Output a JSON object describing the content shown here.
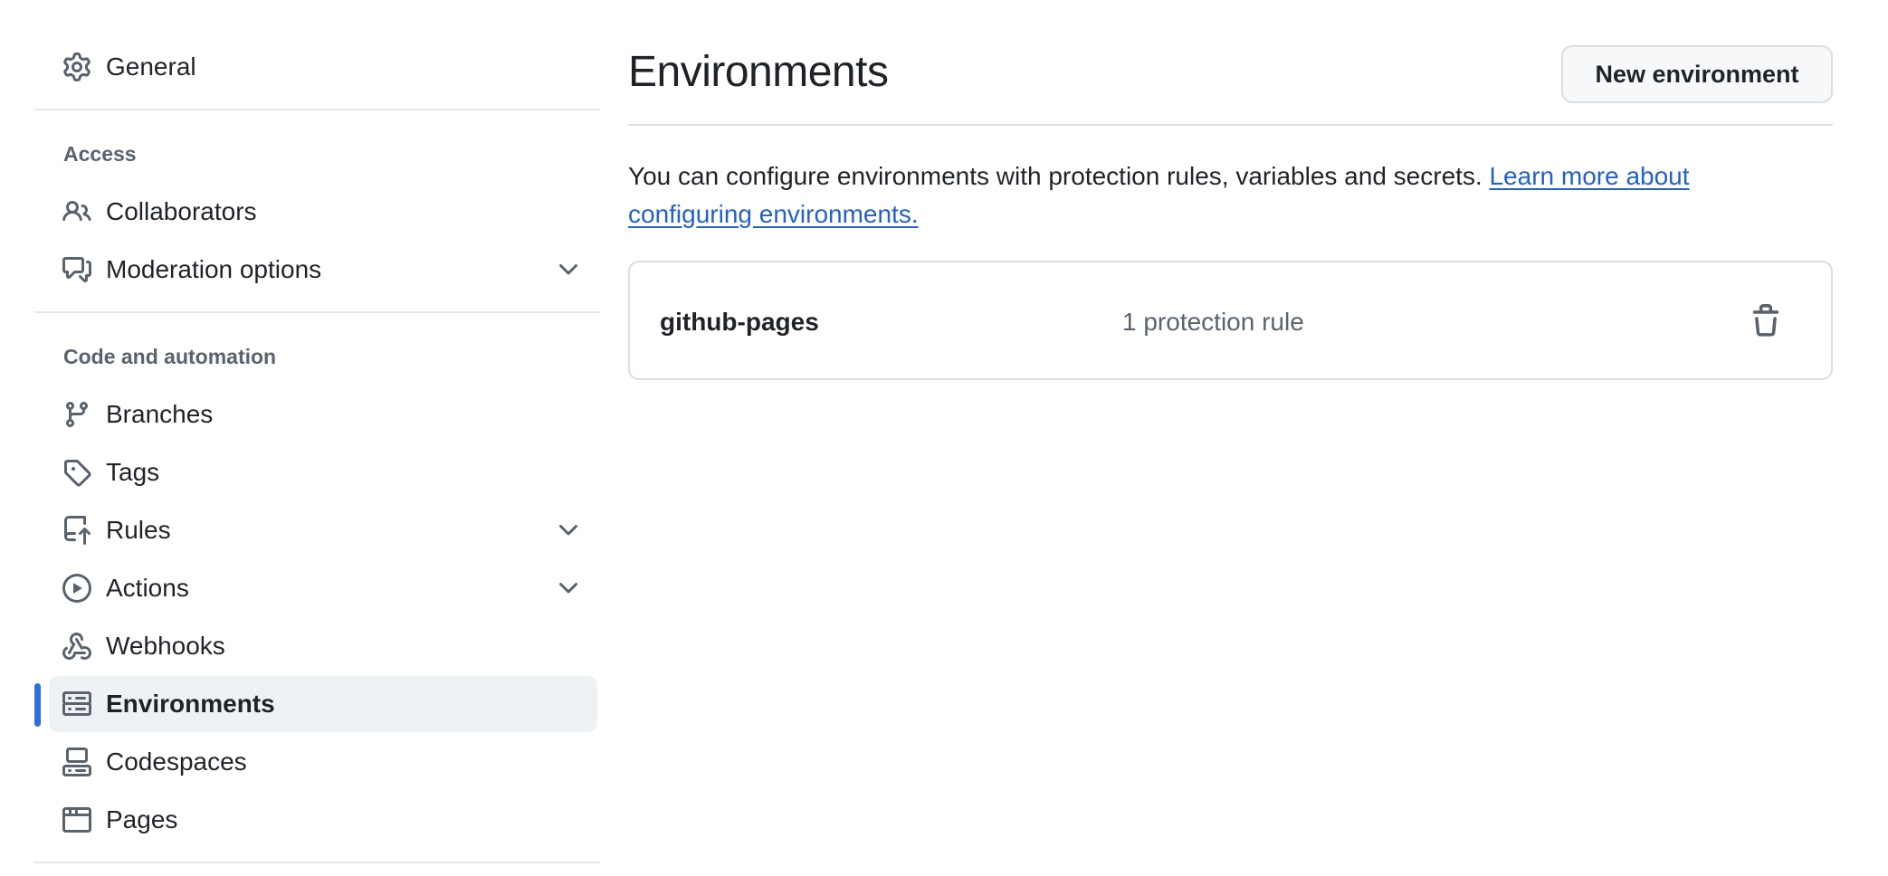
{
  "sidebar": {
    "general": {
      "label": "General",
      "icon": "gear-icon"
    },
    "access_heading": "Access",
    "collaborators": {
      "label": "Collaborators",
      "icon": "people-icon"
    },
    "moderation": {
      "label": "Moderation options",
      "icon": "comment-discussion-icon"
    },
    "code_heading": "Code and automation",
    "branches": {
      "label": "Branches",
      "icon": "git-branch-icon"
    },
    "tags": {
      "label": "Tags",
      "icon": "tag-icon"
    },
    "rules": {
      "label": "Rules",
      "icon": "repo-push-icon"
    },
    "actions": {
      "label": "Actions",
      "icon": "play-icon"
    },
    "webhooks": {
      "label": "Webhooks",
      "icon": "webhook-icon"
    },
    "environments": {
      "label": "Environments",
      "icon": "server-icon",
      "active": true
    },
    "codespaces": {
      "label": "Codespaces",
      "icon": "codespaces-icon"
    },
    "pages": {
      "label": "Pages",
      "icon": "browser-icon"
    }
  },
  "main": {
    "title": "Environments",
    "new_button": "New environment",
    "intro_text": "You can configure environments with protection rules, variables and secrets. ",
    "intro_link": "Learn more about configuring environments.",
    "environments": [
      {
        "name": "github-pages",
        "rules": "1 protection rule"
      }
    ]
  },
  "colors": {
    "accent": "#2f6fdc",
    "link": "#2461c7",
    "active_bg": "#eff2f5"
  }
}
